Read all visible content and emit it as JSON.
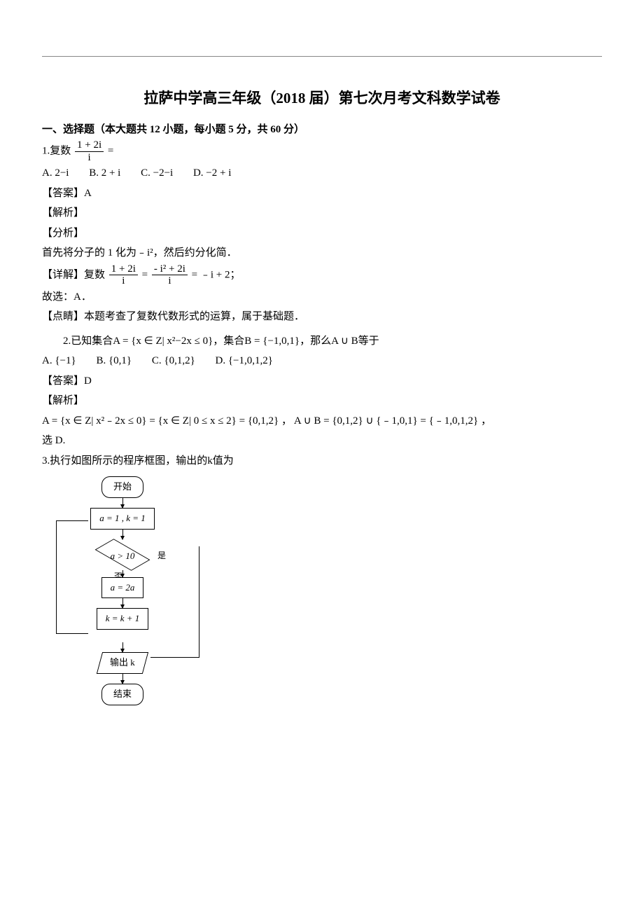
{
  "title": "拉萨中学高三年级（2018 届）第七次月考文科数学试卷",
  "section1": "一、选择题（本大题共 12 小题，每小题 5 分，共 60 分）",
  "q1": {
    "stem_prefix": "1.复数",
    "frac_num": "1 + 2i",
    "frac_den": "i",
    "stem_suffix": " =",
    "optA": "A.  2−i",
    "optB": "B.  2 + i",
    "optC": "C.  −2−i",
    "optD": "D.  −2 + i",
    "answer": "【答案】A",
    "jiexi": "【解析】",
    "fenxi": "【分析】",
    "fenxi_text": "首先将分子的 1 化为﹣i²，然后约分化简．",
    "detail_prefix": "【详解】复数",
    "d_frac1_num": "1 + 2i",
    "d_frac1_den": "i",
    "d_eq": "=",
    "d_frac2_num": "- i² + 2i",
    "d_frac2_den": "i",
    "d_tail": " = ﹣i + 2；",
    "so": "故选：A．",
    "dianjing": "【点睛】本题考查了复数代数形式的运算，属于基础题．"
  },
  "q2": {
    "stem": "2.已知集合A = {x ∈ Z| x²−2x ≤ 0}，集合B = {−1,0,1}，那么A ∪ B等于",
    "optA": "A.  {−1}",
    "optB": "B.  {0,1}",
    "optC": "C.  {0,1,2}",
    "optD": "D.  {−1,0,1,2}",
    "answer": "【答案】D",
    "jiexi": "【解析】",
    "work": "A = {x ∈ Z| x²﹣2x ≤ 0} = {x ∈ Z| 0 ≤ x ≤ 2} = {0,1,2} ， A ∪ B = {0,1,2} ∪ {﹣1,0,1} = {﹣1,0,1,2}   ，",
    "so": "选 D."
  },
  "q3": {
    "stem": "3.执行如图所示的程序框图，输出的k值为"
  },
  "flow": {
    "start": "开始",
    "init": "a = 1 , k = 1",
    "cond": "a > 10",
    "yes": "是",
    "no": "否",
    "update_a": "a = 2a",
    "update_k": "k = k + 1",
    "output": "输出  k",
    "end": "结束"
  }
}
